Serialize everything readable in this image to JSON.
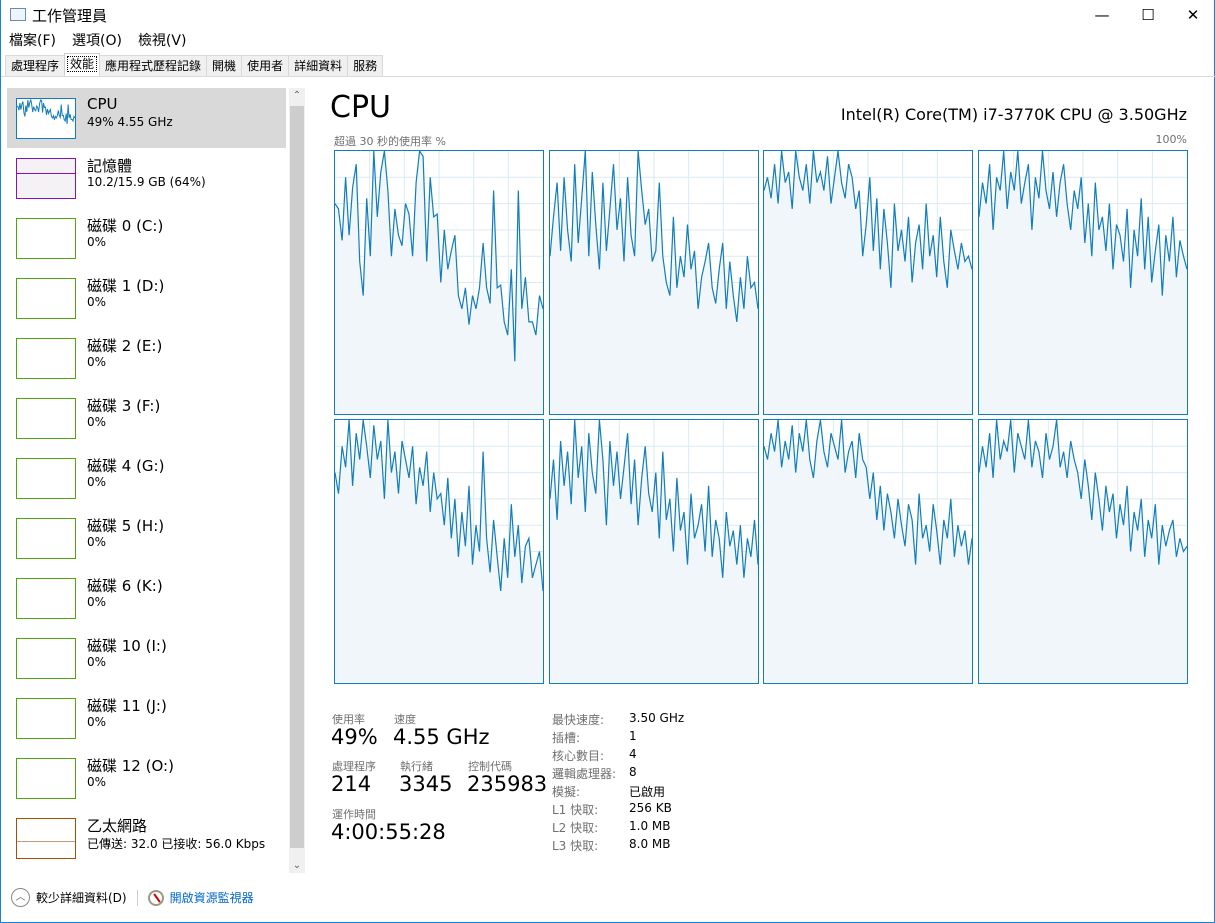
{
  "window": {
    "title": "工作管理員",
    "minimize": "—",
    "maximize": "☐",
    "close": "✕"
  },
  "menu": [
    "檔案(F)",
    "選項(O)",
    "檢視(V)"
  ],
  "tabs": [
    "處理程序",
    "效能",
    "應用程式歷程記錄",
    "開機",
    "使用者",
    "詳細資料",
    "服務"
  ],
  "sidebar": [
    {
      "title": "CPU",
      "sub": "49%  4.55 GHz",
      "color": "#117dbb"
    },
    {
      "title": "記憶體",
      "sub": "10.2/15.9 GB (64%)",
      "color": "#8b12ae"
    },
    {
      "title": "磁碟 0 (C:)",
      "sub": "0%",
      "color": "#4da60c"
    },
    {
      "title": "磁碟 1 (D:)",
      "sub": "0%",
      "color": "#4da60c"
    },
    {
      "title": "磁碟 2 (E:)",
      "sub": "0%",
      "color": "#4da60c"
    },
    {
      "title": "磁碟 3 (F:)",
      "sub": "0%",
      "color": "#4da60c"
    },
    {
      "title": "磁碟 4 (G:)",
      "sub": "0%",
      "color": "#4da60c"
    },
    {
      "title": "磁碟 5 (H:)",
      "sub": "0%",
      "color": "#4da60c"
    },
    {
      "title": "磁碟 6 (K:)",
      "sub": "0%",
      "color": "#4da60c"
    },
    {
      "title": "磁碟 10 (I:)",
      "sub": "0%",
      "color": "#4da60c"
    },
    {
      "title": "磁碟 11 (J:)",
      "sub": "0%",
      "color": "#4da60c"
    },
    {
      "title": "磁碟 12 (O:)",
      "sub": "0%",
      "color": "#4da60c"
    },
    {
      "title": "乙太網路",
      "sub": "已傳送: 32.0 已接收: 56.0 Kbps",
      "color": "#a74f01"
    }
  ],
  "main": {
    "title": "CPU",
    "cpu_name": "Intel(R) Core(TM) i7-3770K CPU @ 3.50GHz",
    "graph_label": "超過 30 秒的使用率 %",
    "graph_max": "100%"
  },
  "stats": {
    "usage_label": "使用率",
    "usage": "49%",
    "speed_label": "速度",
    "speed": "4.55 GHz",
    "proc_label": "處理程序",
    "proc": "214",
    "threads_label": "執行緒",
    "threads": "3345",
    "handles_label": "控制代碼",
    "handles": "235983",
    "uptime_label": "運作時間",
    "uptime": "4:00:55:28"
  },
  "specs": [
    {
      "k": "最快速度:",
      "v": "3.50 GHz"
    },
    {
      "k": "插槽:",
      "v": "1"
    },
    {
      "k": "核心數目:",
      "v": "4"
    },
    {
      "k": "邏輯處理器:",
      "v": "8"
    },
    {
      "k": "模擬:",
      "v": "已啟用"
    },
    {
      "k": "L1 快取:",
      "v": "256 KB"
    },
    {
      "k": "L2 快取:",
      "v": "1.0 MB"
    },
    {
      "k": "L3 快取:",
      "v": "8.0 MB"
    }
  ],
  "footer": {
    "fewer": "較少詳細資料(D)",
    "monitor": "開啟資源監視器"
  },
  "chart_data": {
    "type": "line",
    "title": "超過 30 秒的使用率 %",
    "ylim": [
      0,
      100
    ],
    "series": [
      {
        "name": "core0",
        "values": [
          80,
          78,
          66,
          90,
          68,
          86,
          95,
          58,
          45,
          82,
          60,
          100,
          75,
          92,
          100,
          85,
          60,
          78,
          68,
          64,
          80,
          76,
          60,
          88,
          100,
          98,
          58,
          90,
          75,
          76,
          50,
          70,
          55,
          62,
          68,
          45,
          40,
          48,
          34,
          45,
          40,
          48,
          65,
          48,
          42,
          85,
          48,
          49,
          35,
          30,
          55,
          20,
          85,
          40,
          52,
          35,
          35,
          30,
          45,
          40
        ]
      },
      {
        "name": "core1",
        "values": [
          60,
          75,
          88,
          62,
          90,
          70,
          58,
          95,
          65,
          82,
          100,
          60,
          92,
          72,
          55,
          88,
          62,
          78,
          95,
          70,
          82,
          58,
          90,
          68,
          60,
          100,
          85,
          72,
          78,
          58,
          62,
          88,
          60,
          50,
          45,
          75,
          48,
          60,
          52,
          72,
          55,
          62,
          40,
          52,
          58,
          65,
          48,
          42,
          55,
          65,
          40,
          58,
          45,
          35,
          52,
          40,
          60,
          48,
          50,
          40
        ]
      },
      {
        "name": "core2",
        "values": [
          85,
          90,
          82,
          95,
          80,
          100,
          88,
          92,
          78,
          100,
          90,
          85,
          95,
          80,
          100,
          88,
          92,
          85,
          98,
          80,
          90,
          100,
          88,
          82,
          95,
          90,
          78,
          85,
          60,
          72,
          90,
          62,
          82,
          55,
          78,
          65,
          48,
          80,
          62,
          70,
          58,
          75,
          50,
          65,
          72,
          55,
          80,
          60,
          68,
          52,
          75,
          58,
          48,
          70,
          62,
          55,
          65,
          58,
          60,
          55
        ]
      },
      {
        "name": "core3",
        "values": [
          75,
          88,
          80,
          95,
          70,
          90,
          85,
          100,
          78,
          92,
          85,
          100,
          80,
          88,
          95,
          70,
          90,
          82,
          100,
          85,
          78,
          92,
          75,
          88,
          95,
          80,
          70,
          85,
          78,
          90,
          65,
          80,
          60,
          88,
          70,
          75,
          62,
          80,
          55,
          72,
          68,
          58,
          78,
          48,
          70,
          60,
          82,
          55,
          75,
          50,
          62,
          72,
          45,
          68,
          58,
          75,
          52,
          66,
          60,
          55
        ]
      },
      {
        "name": "core4",
        "values": [
          80,
          72,
          90,
          82,
          100,
          75,
          95,
          85,
          100,
          90,
          78,
          98,
          85,
          92,
          70,
          100,
          80,
          88,
          72,
          92,
          85,
          78,
          90,
          68,
          82,
          75,
          88,
          65,
          80,
          70,
          72,
          60,
          78,
          55,
          70,
          48,
          65,
          52,
          75,
          45,
          60,
          50,
          88,
          55,
          42,
          62,
          48,
          35,
          55,
          40,
          68,
          48,
          60,
          38,
          52,
          55,
          40,
          45,
          50,
          35
        ]
      },
      {
        "name": "core5",
        "values": [
          70,
          85,
          62,
          92,
          75,
          88,
          68,
          100,
          78,
          90,
          65,
          95,
          80,
          72,
          100,
          85,
          60,
          92,
          75,
          88,
          70,
          82,
          95,
          68,
          85,
          60,
          78,
          90,
          72,
          65,
          80,
          55,
          88,
          62,
          70,
          50,
          78,
          58,
          65,
          45,
          72,
          55,
          60,
          68,
          50,
          75,
          48,
          62,
          55,
          40,
          65,
          52,
          58,
          45,
          60,
          40,
          55,
          48,
          62,
          45
        ]
      },
      {
        "name": "core6",
        "values": [
          90,
          85,
          95,
          88,
          100,
          82,
          92,
          85,
          98,
          80,
          95,
          88,
          100,
          85,
          78,
          92,
          100,
          88,
          82,
          95,
          90,
          85,
          100,
          80,
          88,
          92,
          78,
          95,
          85,
          82,
          70,
          80,
          62,
          75,
          58,
          72,
          65,
          55,
          70,
          60,
          52,
          68,
          62,
          45,
          72,
          55,
          60,
          50,
          68,
          58,
          45,
          62,
          55,
          70,
          48,
          60,
          52,
          58,
          45,
          55
        ]
      },
      {
        "name": "core7",
        "values": [
          80,
          90,
          82,
          95,
          78,
          100,
          85,
          92,
          88,
          100,
          80,
          95,
          90,
          85,
          100,
          82,
          92,
          88,
          78,
          95,
          85,
          90,
          100,
          82,
          88,
          78,
          92,
          85,
          80,
          70,
          85,
          75,
          62,
          80,
          70,
          58,
          75,
          65,
          72,
          55,
          68,
          60,
          75,
          50,
          65,
          58,
          70,
          48,
          62,
          55,
          68,
          45,
          60,
          52,
          58,
          62,
          48,
          55,
          50,
          52
        ]
      }
    ]
  }
}
